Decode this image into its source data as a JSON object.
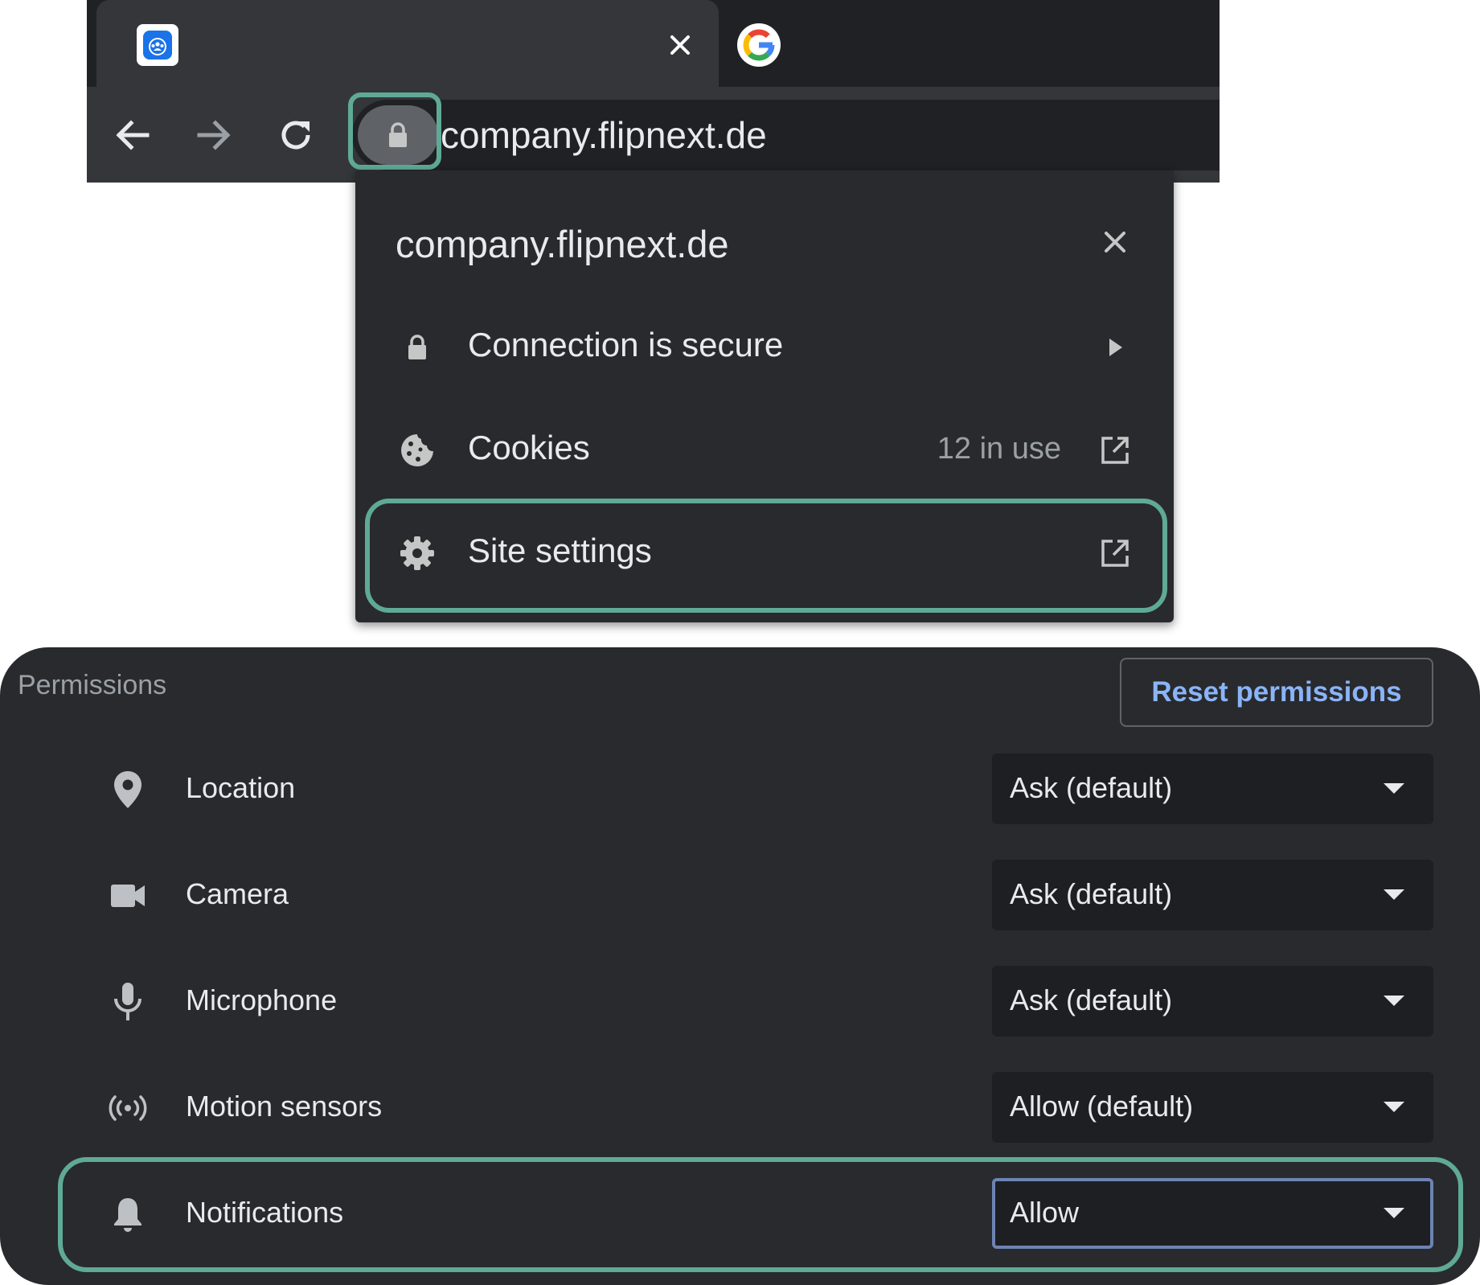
{
  "browser": {
    "address_bar": {
      "url": "company.flipnext.de"
    },
    "tabs": [
      {
        "favicon": "app-favicon-icon",
        "has_close": true
      },
      {
        "favicon": "google-favicon-icon",
        "has_close": false
      }
    ]
  },
  "site_info_popup": {
    "title": "company.flipnext.de",
    "rows": [
      {
        "icon": "lock-icon",
        "label": "Connection is secure",
        "trailing_icon": "chevron-right-icon"
      },
      {
        "icon": "cookie-icon",
        "label": "Cookies",
        "meta": "12 in use",
        "trailing_icon": "external-link-icon"
      },
      {
        "icon": "gear-icon",
        "label": "Site settings",
        "trailing_icon": "external-link-icon"
      }
    ]
  },
  "permissions": {
    "title": "Permissions",
    "reset_label": "Reset permissions",
    "items": [
      {
        "icon": "location-pin-icon",
        "label": "Location",
        "value": "Ask (default)"
      },
      {
        "icon": "camera-icon",
        "label": "Camera",
        "value": "Ask (default)"
      },
      {
        "icon": "microphone-icon",
        "label": "Microphone",
        "value": "Ask (default)"
      },
      {
        "icon": "motion-sensors-icon",
        "label": "Motion sensors",
        "value": "Allow (default)"
      },
      {
        "icon": "bell-icon",
        "label": "Notifications",
        "value": "Allow"
      }
    ]
  },
  "colors": {
    "highlight": "#5fa997",
    "link_accent": "#8ab4f8",
    "chrome_dark": "#202124",
    "panel": "#292a2d"
  }
}
